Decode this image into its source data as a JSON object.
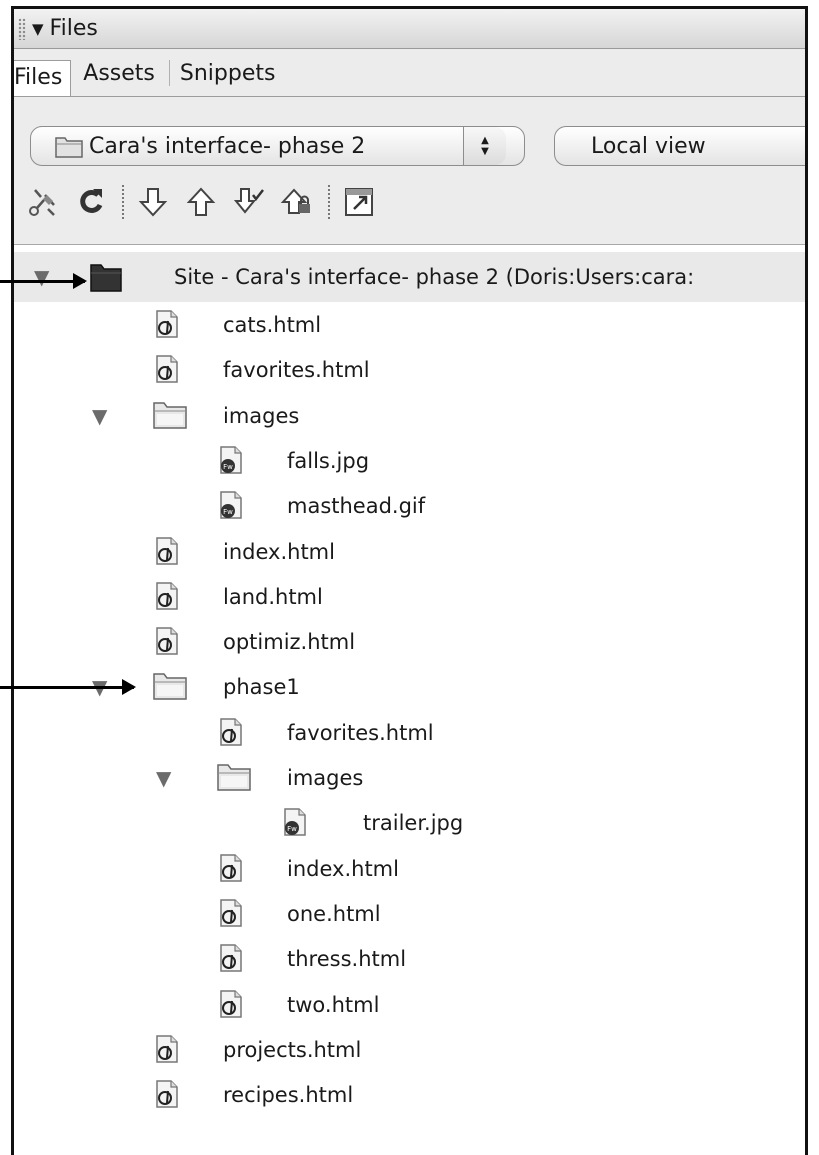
{
  "panel": {
    "title": "Files",
    "tabs": [
      {
        "label": "Files",
        "active": true
      },
      {
        "label": "Assets",
        "active": false
      },
      {
        "label": "Snippets",
        "active": false
      }
    ],
    "site_select": "Cara's interface- phase 2",
    "view_select": "Local view",
    "toolbar_icons": [
      "connect-icon",
      "refresh-icon",
      "get-files-icon",
      "put-files-icon",
      "check-out-icon",
      "check-in-icon",
      "expand-icon"
    ]
  },
  "tree": {
    "site_label": "Site - Cara's interface- phase 2 (Doris:Users:cara:",
    "items": [
      {
        "name": "cats.html",
        "type": "html"
      },
      {
        "name": "favorites.html",
        "type": "html"
      },
      {
        "name": "images",
        "type": "folder"
      },
      {
        "name": "falls.jpg",
        "type": "image"
      },
      {
        "name": "masthead.gif",
        "type": "image"
      },
      {
        "name": "index.html",
        "type": "html"
      },
      {
        "name": "land.html",
        "type": "html"
      },
      {
        "name": "optimiz.html",
        "type": "html"
      },
      {
        "name": "phase1",
        "type": "folder"
      },
      {
        "name": "favorites.html",
        "type": "html"
      },
      {
        "name": "images",
        "type": "folder"
      },
      {
        "name": "trailer.jpg",
        "type": "image"
      },
      {
        "name": "index.html",
        "type": "html"
      },
      {
        "name": "one.html",
        "type": "html"
      },
      {
        "name": "thress.html",
        "type": "html"
      },
      {
        "name": "two.html",
        "type": "html"
      },
      {
        "name": "projects.html",
        "type": "html"
      },
      {
        "name": "recipes.html",
        "type": "html"
      }
    ]
  },
  "colors": {
    "border": "#111111",
    "chrome": "#ececec",
    "selected_row": "#e9e9e9"
  }
}
